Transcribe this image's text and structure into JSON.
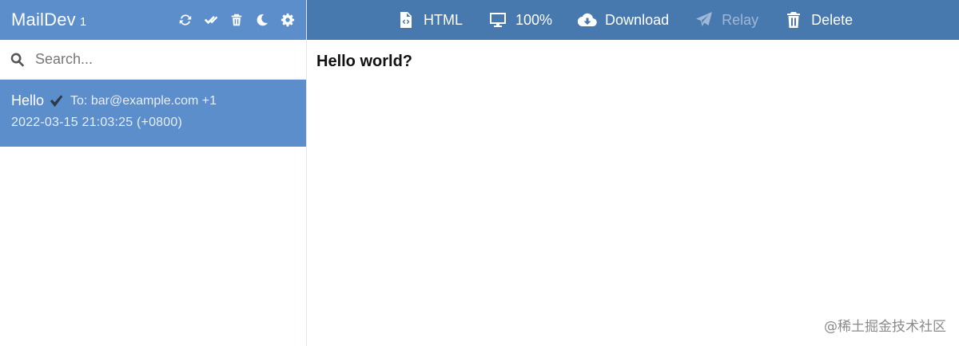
{
  "sidebar": {
    "brand": "MailDev",
    "count": "1",
    "tools": [
      {
        "name": "refresh-icon"
      },
      {
        "name": "mark-all-read-icon"
      },
      {
        "name": "trash-icon"
      },
      {
        "name": "moon-icon"
      },
      {
        "name": "gear-icon"
      }
    ],
    "search": {
      "placeholder": "Search...",
      "value": ""
    },
    "emails": [
      {
        "subject": "Hello",
        "to": "To: bar@example.com +1",
        "date": "2022-03-15 21:03:25 (+0800)"
      }
    ]
  },
  "toolbar": {
    "html_label": "HTML",
    "zoom_label": "100%",
    "download_label": "Download",
    "relay_label": "Relay",
    "delete_label": "Delete"
  },
  "content": {
    "body": "Hello world?"
  },
  "watermark": "@稀土掘金技术社区",
  "colors": {
    "sidebar_header": "#5b8ecb",
    "toolbar": "#4779ae",
    "selected_item": "#5b8ecb",
    "disabled_text": "#9fb8d6"
  }
}
